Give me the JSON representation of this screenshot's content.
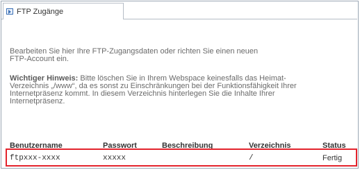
{
  "tab": {
    "icon": "page-arrow-icon",
    "label": "FTP Zugänge"
  },
  "intro": {
    "line1": "Bearbeiten Sie hier Ihre FTP-Zugangsdaten oder richten Sie einen neuen",
    "line2": "FTP-Account ein."
  },
  "notice": {
    "title": "Wichtiger Hinweis:",
    "line1": " Bitte löschen Sie in Ihrem Webspace keinesfalls das Heimat-",
    "line2": "Verzeichnis „/www“, da es sonst zu Einschränkungen bei der Funktionsfähigkeit Ihrer",
    "line3": "Internetpräsenz kommt. In diesem Verzeichnis hinterlegen Sie die Inhalte Ihrer",
    "line4": "Internetpräsenz."
  },
  "table": {
    "headers": [
      "Benutzername",
      "Passwort",
      "Beschreibung",
      "Verzeichnis",
      "Status"
    ],
    "rows": [
      {
        "username": "ftpxxx-xxxx",
        "password": "xxxxx",
        "description": "",
        "directory": "/",
        "status": "Fertig"
      }
    ]
  },
  "colors": {
    "highlight": "#e3232c",
    "border": "#9aa6b3",
    "text": "#6a6a6a"
  }
}
